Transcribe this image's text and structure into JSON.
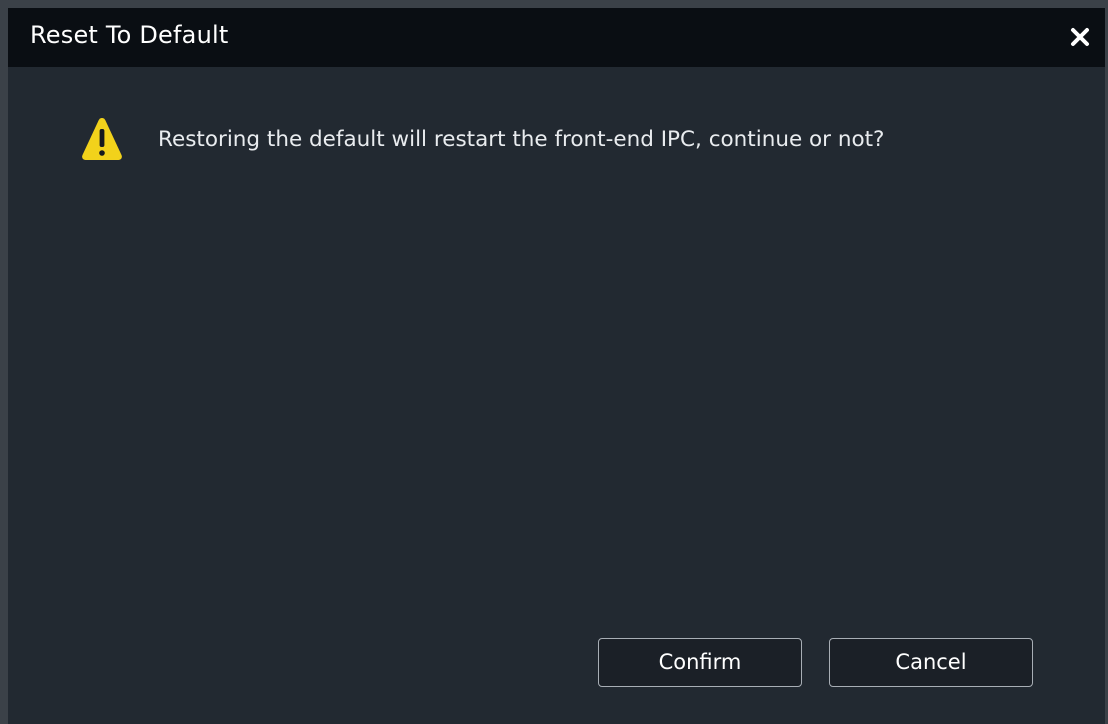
{
  "dialog": {
    "title": "Reset To Default",
    "message": "Restoring the default will restart the front-end IPC, continue or not?",
    "confirm_label": "Confirm",
    "cancel_label": "Cancel",
    "icons": {
      "close": "close-icon",
      "warning": "warning-icon"
    },
    "colors": {
      "warning": "#f2d21b",
      "titlebar": "#0a0e13",
      "body": "#222931"
    }
  }
}
